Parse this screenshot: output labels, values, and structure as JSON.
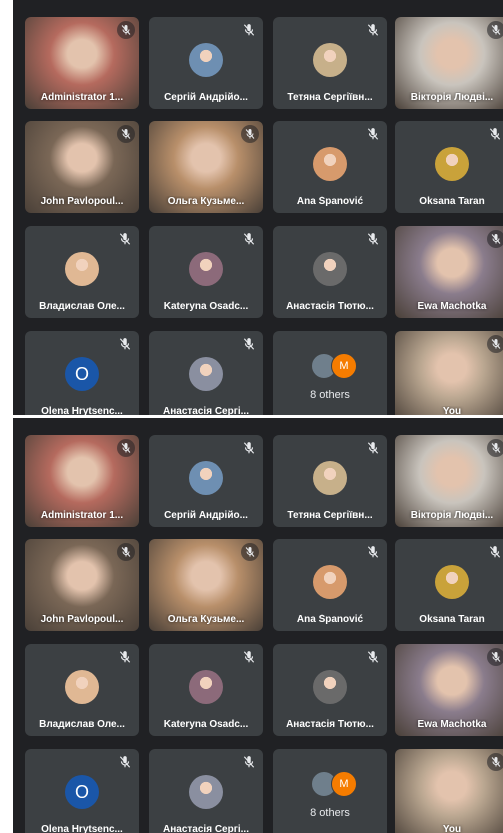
{
  "panels": [
    {
      "tiles": [
        {
          "name": "Administrator 1...",
          "kind": "video",
          "muted": true,
          "bg": "#b56a5e"
        },
        {
          "name": "Сергій Андрійо...",
          "kind": "avatar",
          "muted": true,
          "avatar_color": "#6e8fb2"
        },
        {
          "name": "Тетяна Сергіївн...",
          "kind": "avatar",
          "muted": true,
          "avatar_color": "#c7b08a"
        },
        {
          "name": "Вікторія Людві...",
          "kind": "video",
          "muted": true,
          "bg": "#c9c4bd"
        },
        {
          "name": "John Pavlopoul...",
          "kind": "video",
          "muted": true,
          "bg": "#7a6756"
        },
        {
          "name": "Ольга Кузьме...",
          "kind": "video",
          "muted": true,
          "bg": "#b88f6a"
        },
        {
          "name": "Ana Španović",
          "kind": "avatar",
          "muted": true,
          "avatar_color": "#d79a6c"
        },
        {
          "name": "Oksana Taran",
          "kind": "avatar",
          "muted": true,
          "avatar_color": "#c9a23a"
        },
        {
          "name": "Владислав Оле...",
          "kind": "avatar",
          "muted": true,
          "avatar_color": "#e0b894"
        },
        {
          "name": "Kateryna Osadc...",
          "kind": "avatar",
          "muted": true,
          "avatar_color": "#8c6a7a"
        },
        {
          "name": "Анастасія Тютю...",
          "kind": "avatar",
          "muted": true,
          "avatar_color": "#6a6a6a"
        },
        {
          "name": "Ewa Machotka",
          "kind": "video",
          "muted": true,
          "bg": "#8a7c8c"
        },
        {
          "name": "Olena Hrytsenc...",
          "kind": "letter",
          "muted": true,
          "letter": "O"
        },
        {
          "name": "Анастасія Сергі...",
          "kind": "avatar",
          "muted": true,
          "avatar_color": "#8a8fa0"
        },
        {
          "name": "",
          "kind": "others",
          "muted": false,
          "others_letter": "M",
          "others_label": "8 others"
        },
        {
          "name": "You",
          "kind": "video",
          "muted": true,
          "bg": "#b9a690"
        }
      ]
    },
    {
      "tiles": [
        {
          "name": "Administrator 1...",
          "kind": "video",
          "muted": true,
          "bg": "#b56a5e"
        },
        {
          "name": "Сергій Андрійо...",
          "kind": "avatar",
          "muted": true,
          "avatar_color": "#6e8fb2"
        },
        {
          "name": "Тетяна Сергіївн...",
          "kind": "avatar",
          "muted": true,
          "avatar_color": "#c7b08a"
        },
        {
          "name": "Вікторія Людві...",
          "kind": "video",
          "muted": true,
          "bg": "#c9c4bd"
        },
        {
          "name": "John Pavlopoul...",
          "kind": "video",
          "muted": true,
          "bg": "#7a6756"
        },
        {
          "name": "Ольга Кузьме...",
          "kind": "video",
          "muted": true,
          "bg": "#b88f6a"
        },
        {
          "name": "Ana Španović",
          "kind": "avatar",
          "muted": true,
          "avatar_color": "#d79a6c"
        },
        {
          "name": "Oksana Taran",
          "kind": "avatar",
          "muted": true,
          "avatar_color": "#c9a23a"
        },
        {
          "name": "Владислав Оле...",
          "kind": "avatar",
          "muted": true,
          "avatar_color": "#e0b894"
        },
        {
          "name": "Kateryna Osadc...",
          "kind": "avatar",
          "muted": true,
          "avatar_color": "#8c6a7a"
        },
        {
          "name": "Анастасія Тютю...",
          "kind": "avatar",
          "muted": true,
          "avatar_color": "#6a6a6a"
        },
        {
          "name": "Ewa Machotka",
          "kind": "video",
          "muted": true,
          "bg": "#8a7c8c"
        },
        {
          "name": "Olena Hrytsenc...",
          "kind": "letter",
          "muted": true,
          "letter": "O"
        },
        {
          "name": "Анастасія Сергі...",
          "kind": "avatar",
          "muted": true,
          "avatar_color": "#8a8fa0"
        },
        {
          "name": "",
          "kind": "others",
          "muted": false,
          "others_letter": "M",
          "others_label": "8 others"
        },
        {
          "name": "You",
          "kind": "video",
          "muted": true,
          "bg": "#b9a690"
        }
      ]
    }
  ],
  "icons": {
    "mic_off": "mic-off-icon"
  }
}
